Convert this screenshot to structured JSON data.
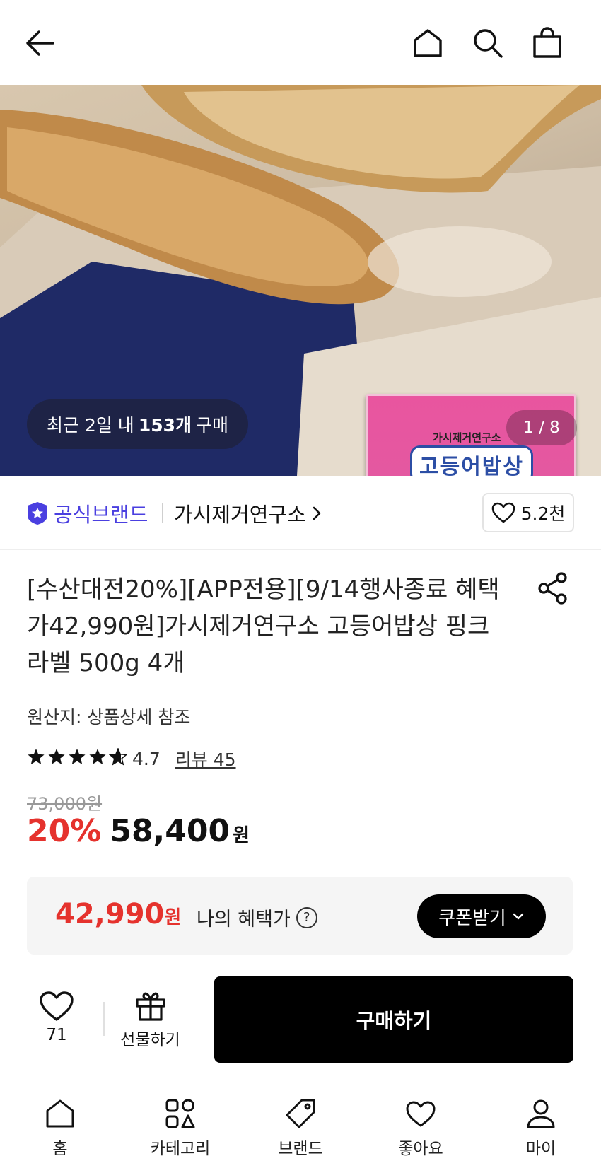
{
  "header": {
    "back_icon": "arrow-left-icon",
    "home_icon": "home-icon",
    "search_icon": "search-icon",
    "cart_icon": "shopping-bag-icon"
  },
  "hero": {
    "recent_purchase_prefix": "최근 2일 내 ",
    "recent_purchase_count": "153개",
    "recent_purchase_suffix": " 구매",
    "pager": "1 / 8",
    "package_brand": "가시제거연구소",
    "package_name": "고등어밥상"
  },
  "brand": {
    "official_label": "공식브랜드",
    "name": "가시제거연구소",
    "likes": "5.2천"
  },
  "product": {
    "title": "[수산대전20%][APP전용][9/14행사종료 혜택가42,990원]가시제거연구소 고등어밥상 핑크라벨 500g 4개",
    "origin": "원산지: 상품상세 참조",
    "rating": "4.7",
    "rating_value": 4.7,
    "review_label": "리뷰 45",
    "original_price": "73,000원",
    "discount": "20%",
    "price": "58,400",
    "price_unit": "원"
  },
  "benefit": {
    "price": "42,990",
    "price_unit": "원",
    "label": "나의 혜택가",
    "help": "?",
    "coupon_button": "쿠폰받기"
  },
  "purchase": {
    "wish_count": "71",
    "gift_label": "선물하기",
    "buy_label": "구매하기"
  },
  "tabs": [
    {
      "label": "홈",
      "icon": "home-icon"
    },
    {
      "label": "카테고리",
      "icon": "category-icon"
    },
    {
      "label": "브랜드",
      "icon": "tag-icon"
    },
    {
      "label": "좋아요",
      "icon": "heart-icon"
    },
    {
      "label": "마이",
      "icon": "person-icon"
    }
  ],
  "colors": {
    "accent_red": "#e5322d",
    "official_purple": "#4a3fe0",
    "button_black": "#000000"
  }
}
